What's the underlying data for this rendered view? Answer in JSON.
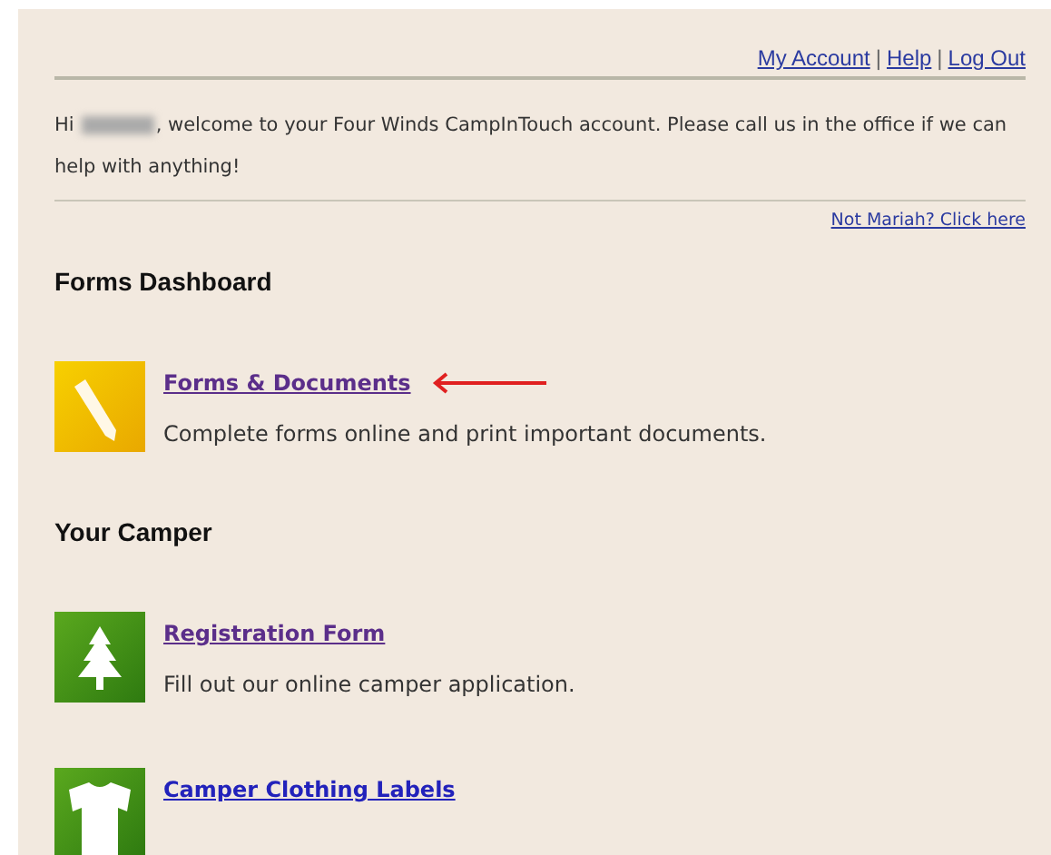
{
  "top_links": [
    {
      "label": "My Account"
    },
    {
      "label": "Help"
    },
    {
      "label": "Log Out"
    }
  ],
  "top_link_separators": [
    "|",
    "|"
  ],
  "greeting": {
    "before": "Hi",
    "after": ", welcome to your Four Winds CampInTouch account. Please call us in the office if we can help with anything!"
  },
  "switch_user_link": "Not Mariah? Click here",
  "sections": [
    {
      "heading": "Forms Dashboard",
      "items": [
        {
          "kind": "pencil",
          "title": "Forms & Documents",
          "visited": true,
          "pointer_arrow": true,
          "description": "Complete forms online and print important documents."
        }
      ]
    },
    {
      "heading": "Your Camper",
      "items": [
        {
          "kind": "tree",
          "title": "Registration Form",
          "visited": true,
          "description": "Fill out our online camper application."
        },
        {
          "kind": "shirt",
          "title": "Camper Clothing Labels",
          "visited": false
        }
      ]
    }
  ]
}
